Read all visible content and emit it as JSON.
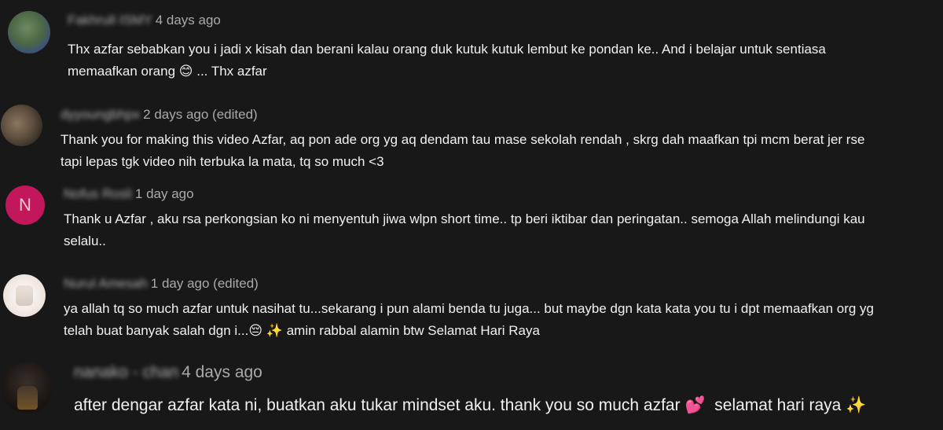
{
  "colors": {
    "background": "#181818",
    "text": "#f1f1f1",
    "meta": "#aaaaaa",
    "avatar_n": "#c2185b"
  },
  "comments": [
    {
      "author": "Fakhrull·ISMY",
      "time": "4 days ago",
      "lines": [
        "Thx azfar sebabkan you i jadi x kisah dan berani kalau orang duk kutuk kutuk lembut ke pondan ke.. And i belajar untuk sentiasa",
        "memaafkan orang",
        "... Thx azfar"
      ],
      "emoji": "😊"
    },
    {
      "author": "dyyoungbhpx",
      "time": "2 days ago (edited)",
      "lines": [
        "Thank you for making this video Azfar, aq pon ade org yg aq dendam tau mase sekolah rendah , skrg dah maafkan tpi mcm berat jer rse",
        "tapi lepas tgk video nih terbuka la mata, tq so much <3"
      ]
    },
    {
      "author": "Nofus Rosli",
      "time": "1 day ago",
      "avatar_letter": "N",
      "lines": [
        "Thank u Azfar , aku rsa perkongsian ko ni menyentuh jiwa wlpn short time.. tp beri iktibar dan peringatan.. semoga Allah melindungi kau",
        "selalu.."
      ]
    },
    {
      "author": "Nurul Amesah",
      "time": "1 day ago (edited)",
      "lines": [
        "ya allah tq so much azfar untuk nasihat tu...sekarang i pun alami benda tu juga... but maybe dgn kata kata you tu i dpt memaafkan org yg",
        "telah buat banyak salah dgn i...",
        "amin rabbal alamin btw Selamat Hari Raya"
      ],
      "emoji_a": "😔",
      "emoji_b": "✨"
    },
    {
      "author": "nanako - chan",
      "time": "4 days ago",
      "lines": [
        "after dengar azfar kata ni, buatkan aku tukar mindset aku. thank you so much azfar",
        "selamat hari raya"
      ],
      "emoji_a": "💕",
      "emoji_b": "✨"
    }
  ]
}
